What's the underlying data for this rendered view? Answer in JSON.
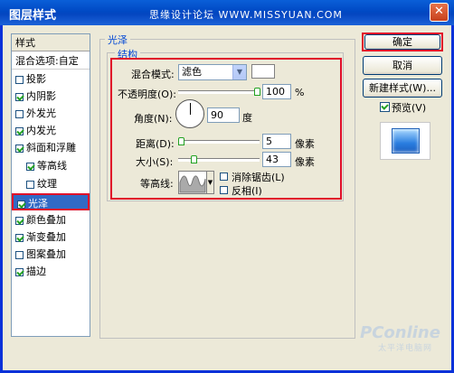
{
  "window": {
    "title": "图层样式",
    "watermark": "思缘设计论坛 WWW.MISSYUAN.COM",
    "close_glyph": "✕"
  },
  "sidebar": {
    "header": "样式",
    "items": [
      {
        "label": "混合选项:自定",
        "type": "plain"
      },
      {
        "label": "投影",
        "checked": false
      },
      {
        "label": "内阴影",
        "checked": true
      },
      {
        "label": "外发光",
        "checked": false
      },
      {
        "label": "内发光",
        "checked": true
      },
      {
        "label": "斜面和浮雕",
        "checked": true
      },
      {
        "label": "等高线",
        "checked": true,
        "sub": true
      },
      {
        "label": "纹理",
        "checked": false,
        "sub": true
      },
      {
        "label": "光泽",
        "checked": true,
        "selected": true
      },
      {
        "label": "颜色叠加",
        "checked": true
      },
      {
        "label": "渐变叠加",
        "checked": true
      },
      {
        "label": "图案叠加",
        "checked": false
      },
      {
        "label": "描边",
        "checked": true
      }
    ]
  },
  "satin": {
    "group_title": "光泽",
    "structure_title": "结构",
    "blend_mode_label": "混合模式:",
    "blend_mode_value": "滤色",
    "blend_color": "#ffffff",
    "opacity_label": "不透明度(O):",
    "opacity_value": "100",
    "opacity_unit": "%",
    "angle_label": "角度(N):",
    "angle_value": "90",
    "angle_unit": "度",
    "distance_label": "距离(D):",
    "distance_value": "5",
    "distance_unit": "像素",
    "size_label": "大小(S):",
    "size_value": "43",
    "size_unit": "像素",
    "contour_label": "等高线:",
    "antialias_label": "消除锯齿(L)",
    "antialias_checked": false,
    "invert_label": "反相(I)",
    "invert_checked": false
  },
  "buttons": {
    "ok": "确定",
    "cancel": "取消",
    "new_style": "新建样式(W)...",
    "preview_label": "预览(V)",
    "preview_checked": true
  },
  "brand": {
    "logo": "PConline",
    "tagline": "太平洋电脑网"
  },
  "colors": {
    "highlight_red": "#e0102a",
    "selection_blue": "#316ac5",
    "title_blue": "#0a5fd8"
  }
}
